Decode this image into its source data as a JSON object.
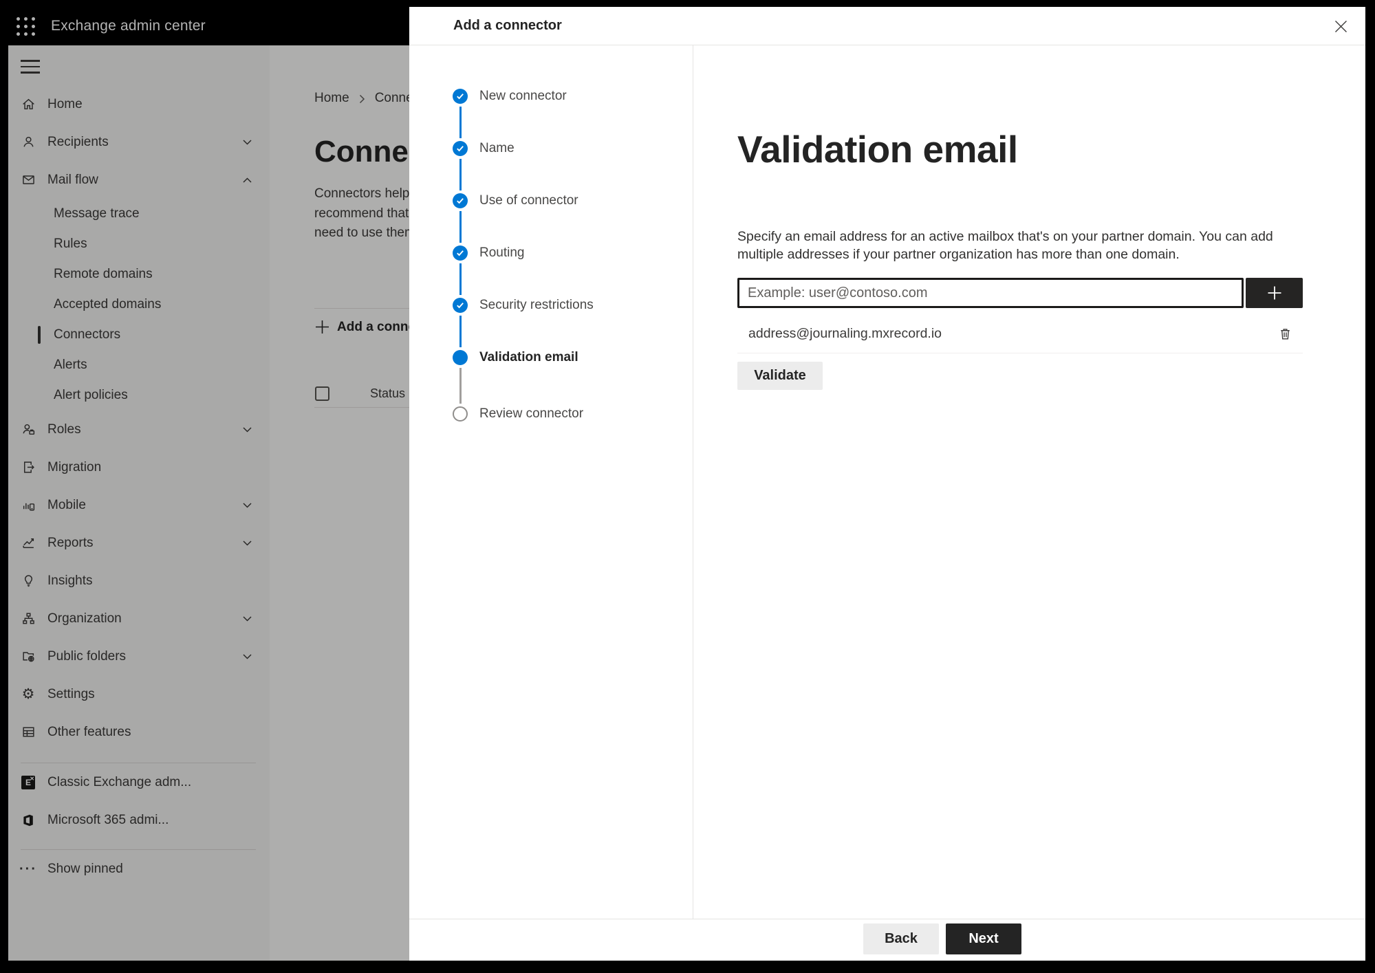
{
  "topbar": {
    "title": "Exchange admin center"
  },
  "sidebar": {
    "items": [
      {
        "label": "Home"
      },
      {
        "label": "Recipients"
      },
      {
        "label": "Mail flow"
      },
      {
        "label": "Message trace"
      },
      {
        "label": "Rules"
      },
      {
        "label": "Remote domains"
      },
      {
        "label": "Accepted domains"
      },
      {
        "label": "Connectors"
      },
      {
        "label": "Alerts"
      },
      {
        "label": "Alert policies"
      },
      {
        "label": "Roles"
      },
      {
        "label": "Migration"
      },
      {
        "label": "Mobile"
      },
      {
        "label": "Reports"
      },
      {
        "label": "Insights"
      },
      {
        "label": "Organization"
      },
      {
        "label": "Public folders"
      },
      {
        "label": "Settings"
      },
      {
        "label": "Other features"
      },
      {
        "label": "Classic Exchange adm..."
      },
      {
        "label": "Microsoft 365 admi..."
      },
      {
        "label": "Show pinned"
      }
    ]
  },
  "page": {
    "breadcrumb": [
      "Home",
      "Connectors"
    ],
    "title": "Connectors",
    "description_lines": [
      "Connectors help",
      "recommend that",
      "need to use them"
    ],
    "add_label": "Add a connector",
    "status_header": "Status"
  },
  "panel": {
    "title": "Add a connector",
    "steps": [
      {
        "label": "New connector",
        "state": "completed"
      },
      {
        "label": "Name",
        "state": "completed"
      },
      {
        "label": "Use of connector",
        "state": "completed"
      },
      {
        "label": "Routing",
        "state": "completed"
      },
      {
        "label": "Security restrictions",
        "state": "completed"
      },
      {
        "label": "Validation email",
        "state": "current"
      },
      {
        "label": "Review connector",
        "state": "upcoming"
      }
    ],
    "content": {
      "heading": "Validation email",
      "description": "Specify an email address for an active mailbox that's on your partner domain. You can add multiple addresses if your partner organization has more than one domain.",
      "email_placeholder": "Example: user@contoso.com",
      "addresses": [
        "address@journaling.mxrecord.io"
      ],
      "validate_label": "Validate"
    },
    "footer": {
      "back_label": "Back",
      "next_label": "Next"
    }
  },
  "icons": {
    "gear": "⚙",
    "more": "···",
    "exchange_letter": "E",
    "exchange_x": "✕"
  },
  "colors": {
    "accent": "#0078d4",
    "dark_button": "#242424",
    "topbar": "#000000",
    "sidebar_bg": "#f3f2f1"
  }
}
